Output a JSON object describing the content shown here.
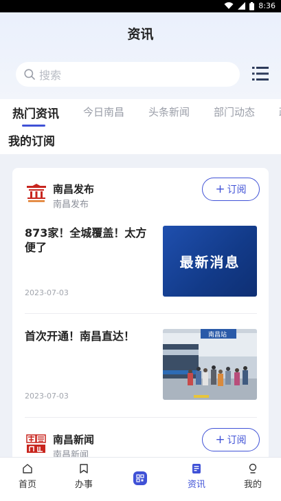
{
  "status_bar": {
    "time": "8:36"
  },
  "header": {
    "title": "资讯"
  },
  "search": {
    "placeholder": "搜索",
    "icon": "search-icon"
  },
  "tabs": [
    {
      "label": "热门资讯",
      "active": true
    },
    {
      "label": "今日南昌"
    },
    {
      "label": "头条新闻"
    },
    {
      "label": "部门动态"
    },
    {
      "label": "政"
    }
  ],
  "section_title": "我的订阅",
  "publishers": [
    {
      "name": "南昌发布",
      "subtitle": "南昌发布",
      "follow_label": "订阅",
      "articles": [
        {
          "headline": "873家！全城覆盖！太方便了",
          "date": "2023-07-03",
          "thumb_text": "最新消息"
        },
        {
          "headline": "首次开通！南昌直达！",
          "date": "2023-07-03",
          "thumb_text": "南昌站"
        }
      ]
    },
    {
      "name": "南昌新闻",
      "subtitle": "南昌新闻",
      "follow_label": "订阅"
    }
  ],
  "bottom_nav": [
    {
      "label": "首页",
      "icon": "home-icon"
    },
    {
      "label": "办事",
      "icon": "bookmark-icon"
    },
    {
      "label": "",
      "icon": "qr-code-icon"
    },
    {
      "label": "资讯",
      "icon": "news-icon",
      "active": true
    },
    {
      "label": "我的",
      "icon": "user-icon"
    }
  ],
  "colors": {
    "accent": "#3f51d6",
    "background": "#eef1f7"
  }
}
